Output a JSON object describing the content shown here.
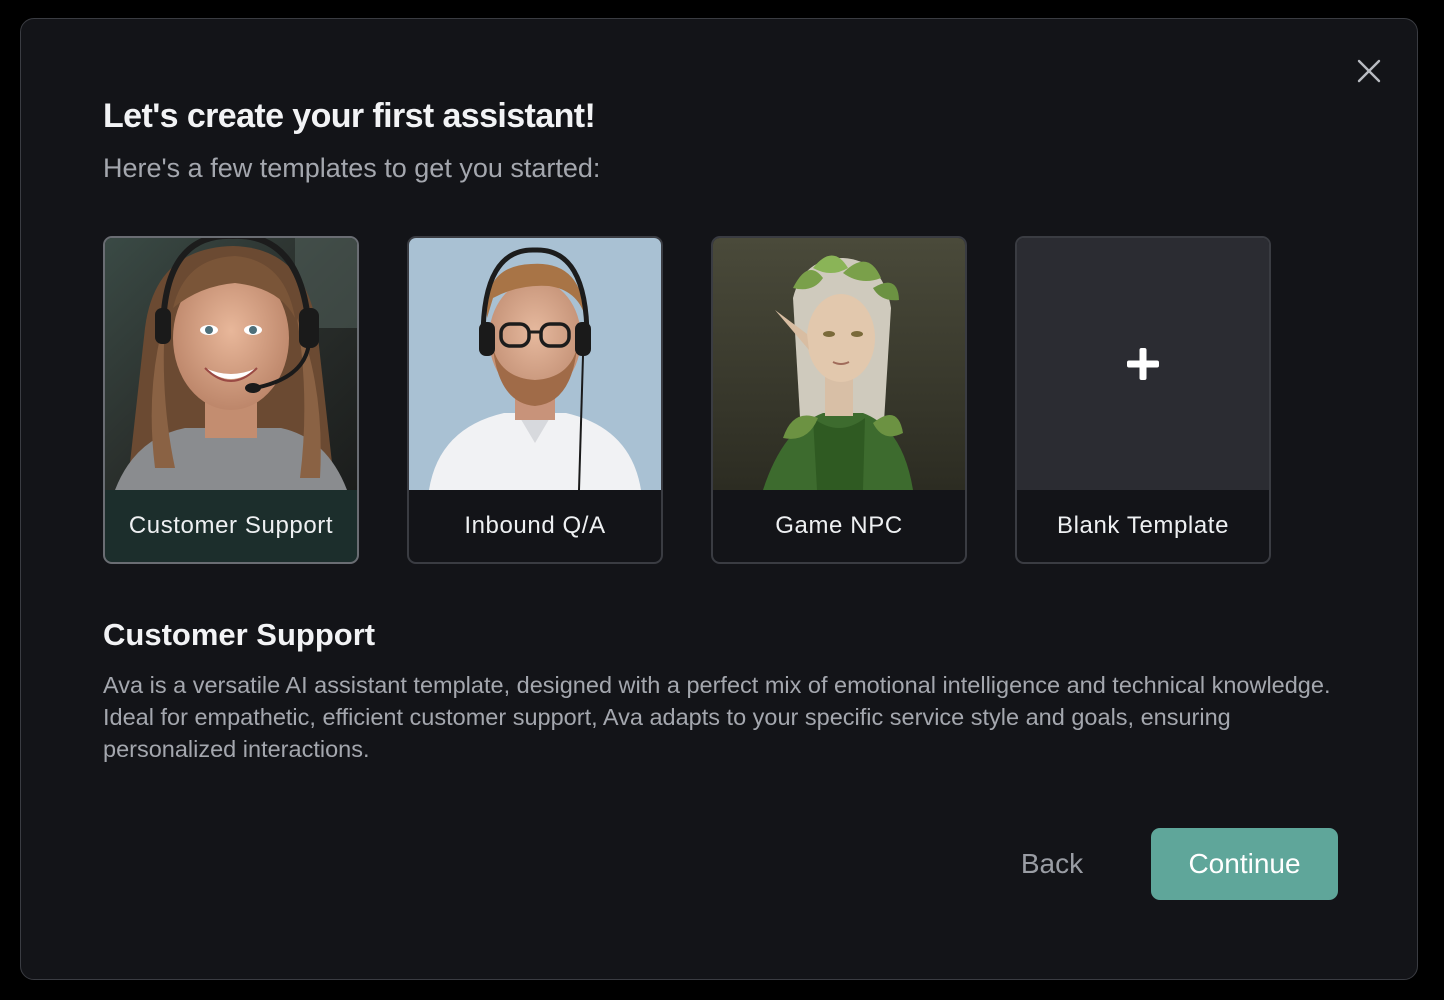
{
  "dialog": {
    "title": "Let's create your first assistant!",
    "subtitle": "Here's a few templates to get you started:",
    "close_icon": "close-icon"
  },
  "templates": [
    {
      "label": "Customer Support",
      "selected": true,
      "image": "woman-with-headset-photo"
    },
    {
      "label": "Inbound Q/A",
      "selected": false,
      "image": "man-with-headset-photo"
    },
    {
      "label": "Game NPC",
      "selected": false,
      "image": "elf-character-illustration"
    },
    {
      "label": "Blank Template",
      "selected": false,
      "image": "plus-icon"
    }
  ],
  "selected_template": {
    "title": "Customer Support",
    "description": "Ava is a versatile AI assistant template, designed with a perfect mix of emotional intelligence and technical knowledge. Ideal for empathetic, efficient customer support, Ava adapts to your specific service style and goals, ensuring personalized interactions."
  },
  "actions": {
    "back_label": "Back",
    "continue_label": "Continue"
  },
  "colors": {
    "modal_background": "#131418",
    "accent": "#5fa69a",
    "selected_card": "#1c2e2c"
  }
}
